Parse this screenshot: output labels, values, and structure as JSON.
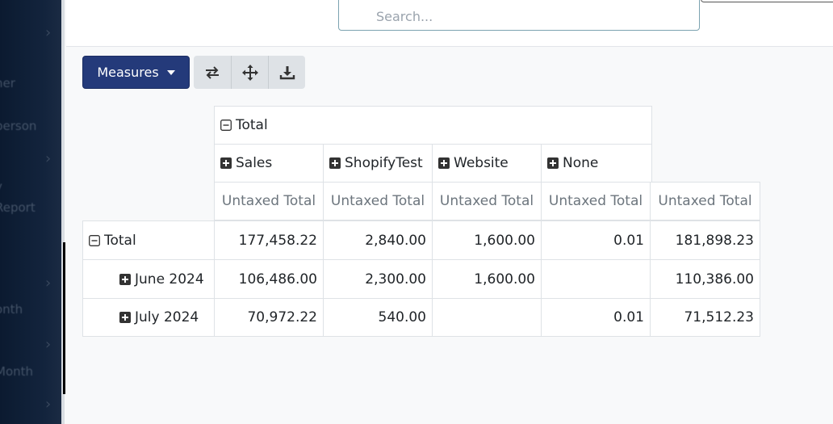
{
  "sidebar": {
    "items": [
      "ner",
      "person",
      "y",
      "Report",
      "onth",
      "Month"
    ]
  },
  "search": {
    "placeholder": "Search..."
  },
  "toolbar": {
    "measures_label": "Measures"
  },
  "pivot": {
    "column_total_label": "Total",
    "columns": [
      {
        "label": "Sales"
      },
      {
        "label": "ShopifyTest"
      },
      {
        "label": "Website"
      },
      {
        "label": "None"
      }
    ],
    "measure_label": "Untaxed Total",
    "rows": [
      {
        "label": "Total",
        "values": [
          "177,458.22",
          "2,840.00",
          "1,600.00",
          "0.01",
          "181,898.23"
        ]
      },
      {
        "label": "June 2024",
        "values": [
          "106,486.00",
          "2,300.00",
          "1,600.00",
          "",
          "110,386.00"
        ]
      },
      {
        "label": "July 2024",
        "values": [
          "70,972.22",
          "540.00",
          "",
          "0.01",
          "71,512.23"
        ]
      }
    ]
  }
}
